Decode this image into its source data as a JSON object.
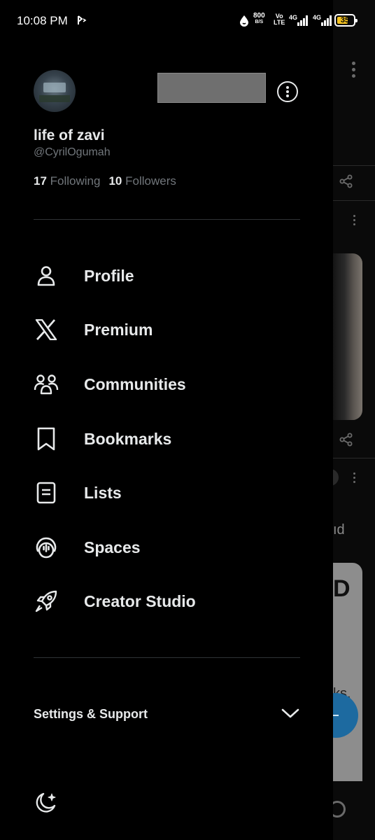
{
  "status_bar": {
    "time": "10:08 PM",
    "net_speed_value": "800",
    "net_speed_unit": "B/S",
    "volte_top": "Vo",
    "volte_bottom": "LTE",
    "sig1_label": "4G",
    "sig2_label": "4G",
    "battery_level": "35"
  },
  "profile": {
    "display_name": "life of zavi",
    "handle": "@CyrilOgumah",
    "following_count": "17",
    "following_label": "Following",
    "followers_count": "10",
    "followers_label": "Followers"
  },
  "menu": [
    {
      "label": "Profile",
      "icon": "person-icon"
    },
    {
      "label": "Premium",
      "icon": "x-logo-icon"
    },
    {
      "label": "Communities",
      "icon": "communities-icon"
    },
    {
      "label": "Bookmarks",
      "icon": "bookmark-icon"
    },
    {
      "label": "Lists",
      "icon": "list-icon"
    },
    {
      "label": "Spaces",
      "icon": "spaces-icon"
    },
    {
      "label": "Creator Studio",
      "icon": "rocket-icon"
    }
  ],
  "settings": {
    "label": "Settings & Support",
    "state": "collapsed"
  },
  "background": {
    "partial_text_1": "ıd",
    "card_letter": "D",
    "card_text": "ks."
  },
  "colors": {
    "background": "#000000",
    "primary_text": "#e7e9ea",
    "secondary_text": "#71767b",
    "divider": "#2f3336",
    "battery": "#f4c21f"
  }
}
